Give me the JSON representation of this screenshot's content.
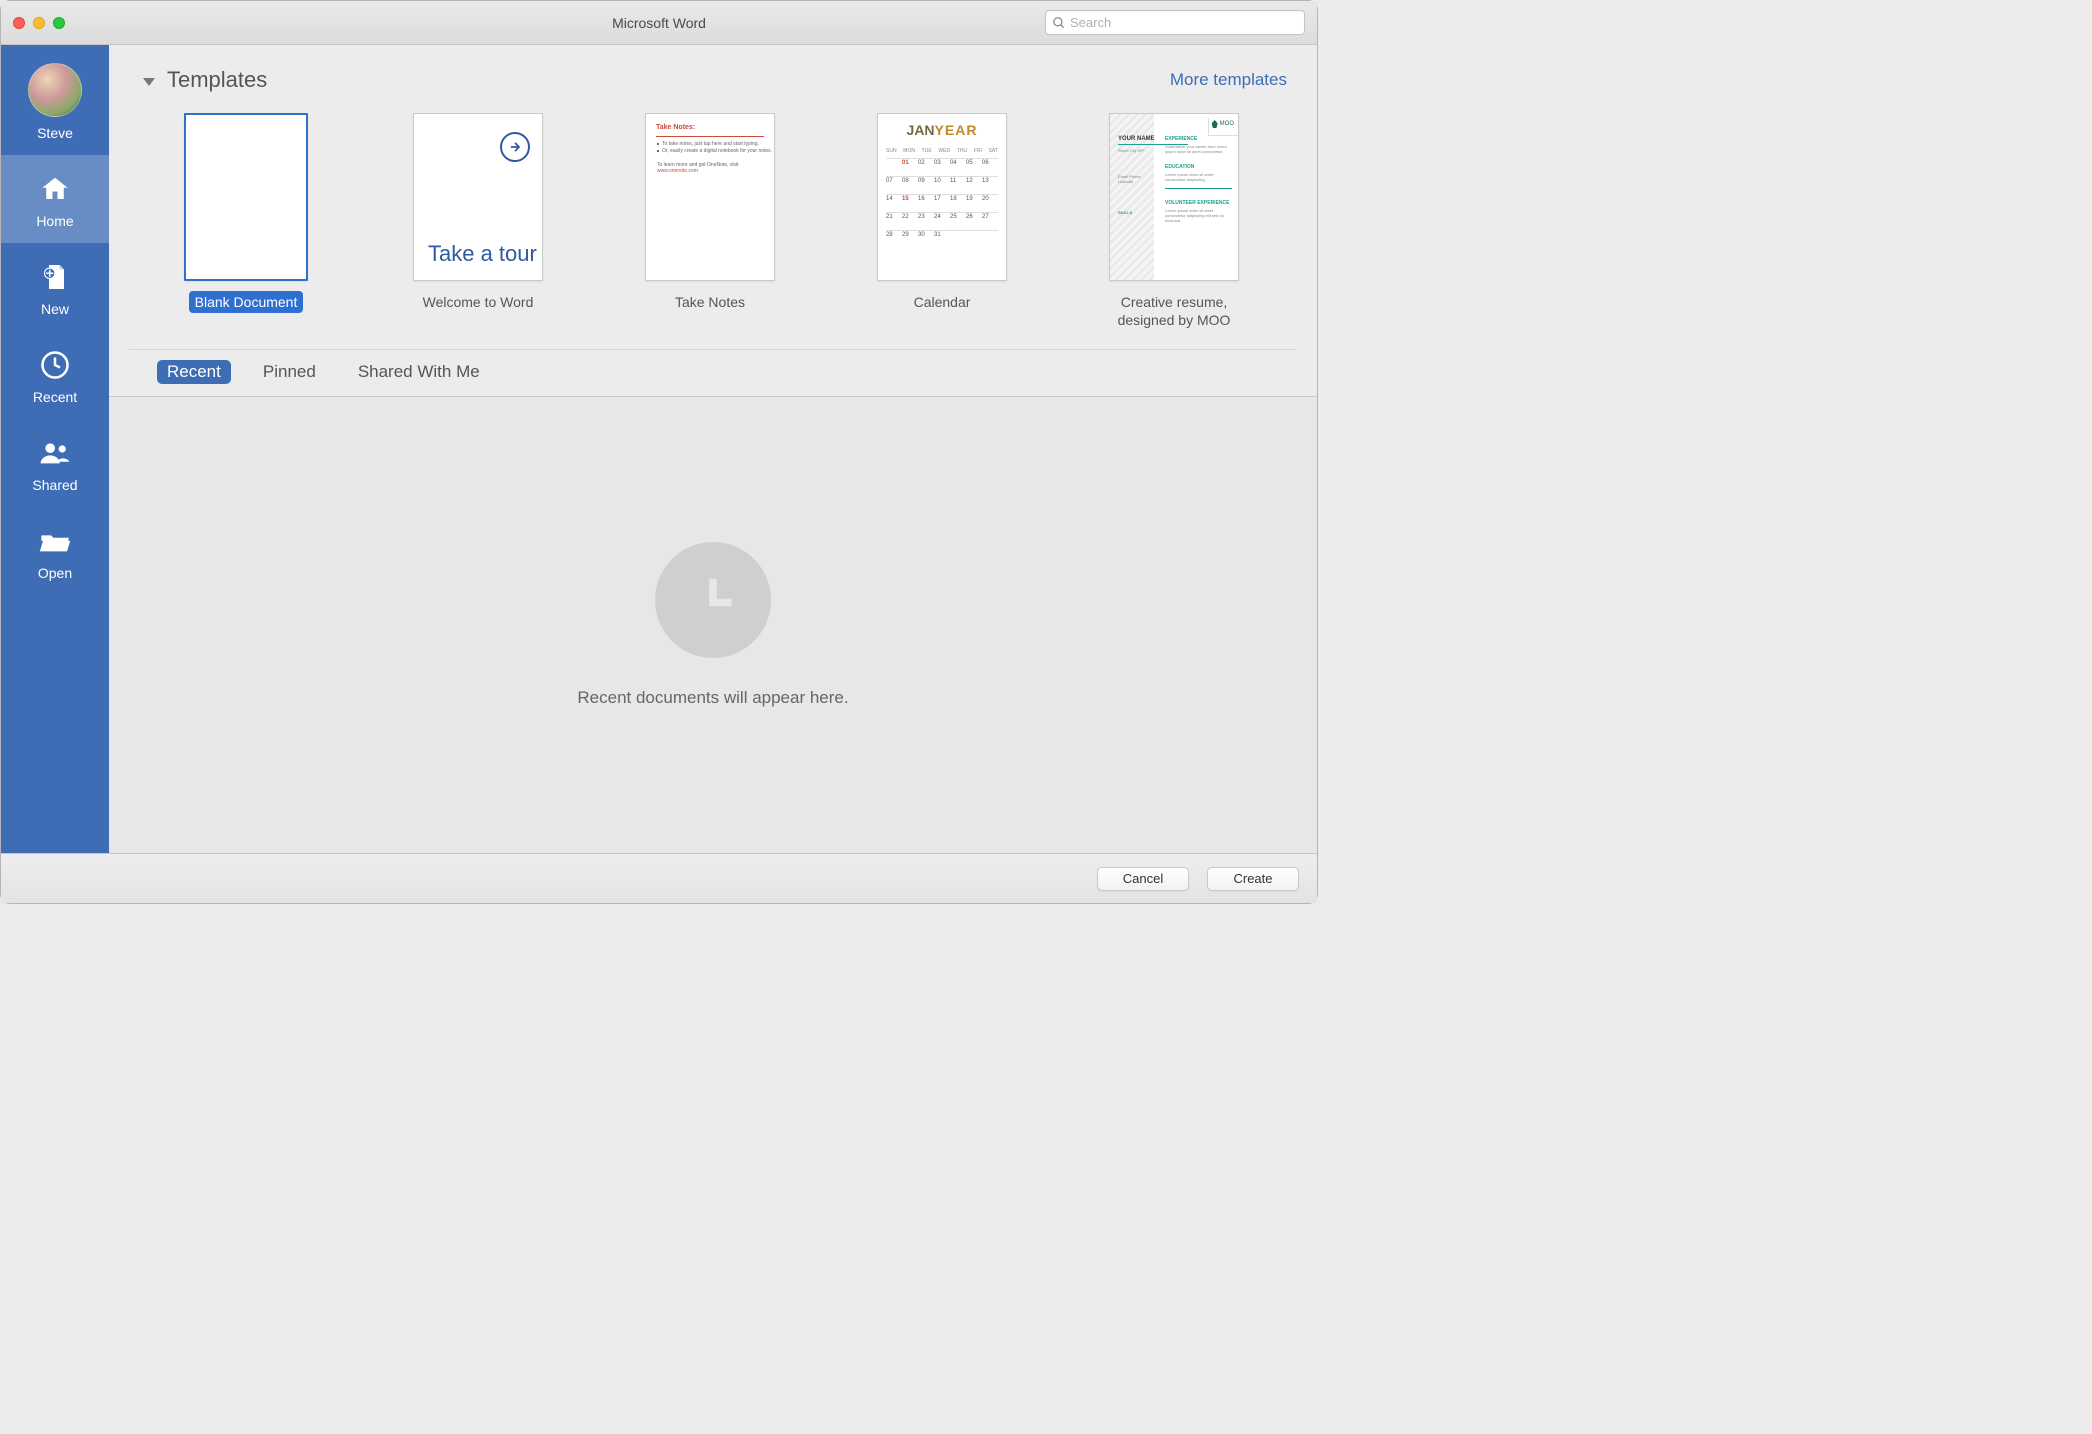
{
  "window": {
    "title": "Microsoft Word",
    "search_placeholder": "Search"
  },
  "sidebar": {
    "user_name": "Steve",
    "items": [
      {
        "id": "home",
        "label": "Home",
        "active": true
      },
      {
        "id": "new",
        "label": "New",
        "active": false
      },
      {
        "id": "recent",
        "label": "Recent",
        "active": false
      },
      {
        "id": "shared",
        "label": "Shared",
        "active": false
      },
      {
        "id": "open",
        "label": "Open",
        "active": false
      }
    ]
  },
  "templates": {
    "heading": "Templates",
    "more_link": "More templates",
    "items": [
      {
        "label": "Blank Document",
        "selected": true
      },
      {
        "label": "Welcome to Word",
        "thumb_text": "Take a tour"
      },
      {
        "label": "Take Notes",
        "thumb_title": "Take Notes:"
      },
      {
        "label": "Calendar",
        "thumb_month": "JAN",
        "thumb_year": "YEAR"
      },
      {
        "label": "Creative resume, designed by MOO",
        "thumb_brand": "MOO",
        "thumb_name": "YOUR NAME"
      }
    ]
  },
  "tabs": {
    "items": [
      {
        "label": "Recent",
        "active": true
      },
      {
        "label": "Pinned",
        "active": false
      },
      {
        "label": "Shared With Me",
        "active": false
      }
    ]
  },
  "recent": {
    "empty_message": "Recent documents will appear here."
  },
  "footer": {
    "cancel_label": "Cancel",
    "create_label": "Create"
  },
  "calendar_preview": {
    "weekdays": [
      "SUN",
      "MON",
      "TUE",
      "WED",
      "THU",
      "FRI",
      "SAT"
    ]
  }
}
